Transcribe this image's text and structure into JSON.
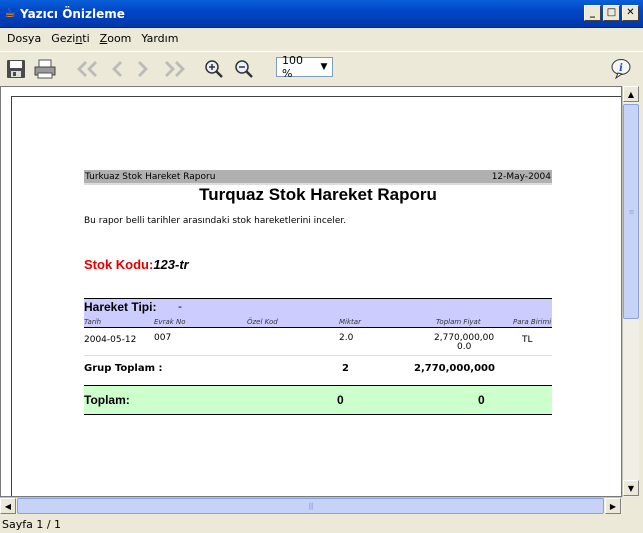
{
  "window": {
    "title": "Yazıcı Önizleme"
  },
  "menu": [
    {
      "label_pre": "Dosya",
      "label_u": "",
      "label_post": ""
    },
    {
      "label_pre": "Gezi",
      "label_u": "n",
      "label_post": "ti"
    },
    {
      "label_pre": "",
      "label_u": "Z",
      "label_post": "oom"
    },
    {
      "label_pre": "Yardım",
      "label_u": "",
      "label_post": ""
    }
  ],
  "toolbar": {
    "zoom_value": "100 %",
    "icons": [
      "save-icon",
      "print-icon",
      "first-page-icon",
      "previous-page-icon",
      "next-page-icon",
      "last-page-icon",
      "zoom-in-icon",
      "zoom-out-icon",
      "info-icon"
    ]
  },
  "report": {
    "header_left": "Turkuaz Stok Hareket Raporu",
    "header_right": "12-May-2004",
    "title": "Turquaz Stok Hareket Raporu",
    "description": "Bu rapor belli tarihler arasındaki stok hareketlerini inceler.",
    "stok_label": "Stok Kodu:",
    "stok_value": "123-tr",
    "hareket_label": "Hareket Tipi:",
    "hareket_value": "-",
    "columns": {
      "tarih": "Tarih",
      "evrak": "Evrak No",
      "ozel": "Özel Kod",
      "miktar": "Miktar",
      "fiyat": "Toplam Fiyat",
      "para": "Para Birimi"
    },
    "row": {
      "tarih": "2004-05-12",
      "evrak": "007",
      "miktar": "2.0",
      "fiyat": "2,770,000,00",
      "fiyat2": "0.0",
      "para": "TL"
    },
    "grup": {
      "label": "Grup Toplam :",
      "miktar": "2",
      "fiyat": "2,770,000,000"
    },
    "toplam": {
      "label": "Toplam:",
      "miktar": "0",
      "fiyat": "0"
    }
  },
  "status": {
    "text": "Sayfa 1 / 1"
  }
}
